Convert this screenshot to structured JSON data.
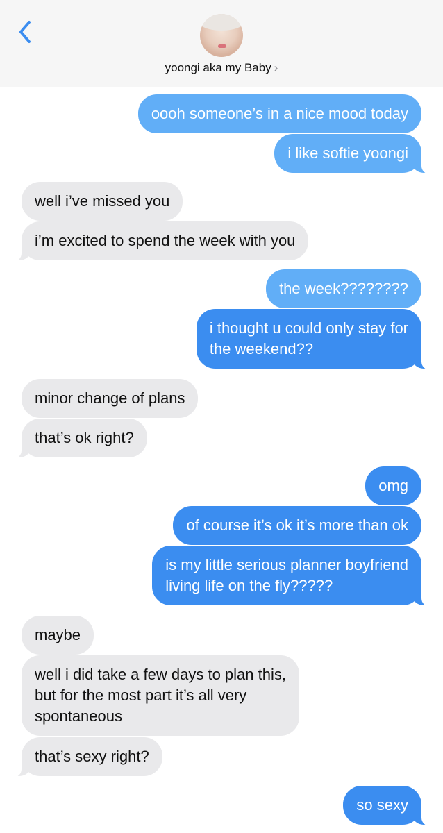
{
  "header": {
    "contact_name": "yoongi aka my Baby",
    "chevron": "›",
    "back_icon": "chevron-left-icon",
    "accent_color": "#3b8df0"
  },
  "messages": [
    {
      "from": "me",
      "lines": [
        "oooh someone’s in a nice mood today"
      ]
    },
    {
      "from": "me",
      "lines": [
        "i like softie yoongi"
      ]
    },
    {
      "from": "them",
      "lines": [
        "well i’ve missed you"
      ]
    },
    {
      "from": "them",
      "lines": [
        "i’m excited to spend the week with you"
      ]
    },
    {
      "from": "me",
      "lines": [
        "the week????????"
      ]
    },
    {
      "from": "me",
      "lines": [
        "i thought u could only stay for",
        "the weekend??"
      ]
    },
    {
      "from": "them",
      "lines": [
        "minor change of plans"
      ]
    },
    {
      "from": "them",
      "lines": [
        "that’s ok right?"
      ]
    },
    {
      "from": "me",
      "lines": [
        "omg"
      ]
    },
    {
      "from": "me",
      "lines": [
        "of course it’s ok it’s more than ok"
      ]
    },
    {
      "from": "me",
      "lines": [
        "is my little serious planner boyfriend",
        "living life on the fly?????"
      ]
    },
    {
      "from": "them",
      "lines": [
        "maybe"
      ]
    },
    {
      "from": "them",
      "lines": [
        "well i did take a few days to plan this,",
        "but for the most part it’s all very",
        "spontaneous"
      ]
    },
    {
      "from": "them",
      "lines": [
        "that’s sexy right?"
      ]
    },
    {
      "from": "me",
      "lines": [
        "so sexy"
      ]
    }
  ]
}
